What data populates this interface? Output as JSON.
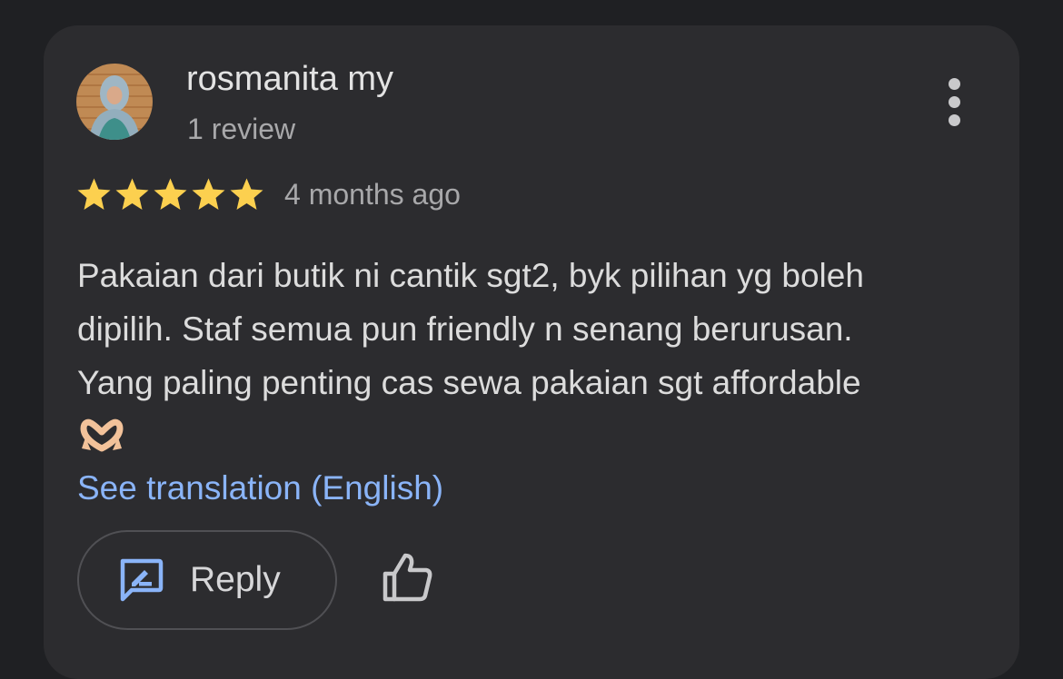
{
  "review": {
    "author_name": "rosmanita my",
    "review_count": "1 review",
    "rating": 5,
    "rating_max": 5,
    "time_ago": "4 months ago",
    "text_lines": [
      "Pakaian dari butik ni cantik sgt2, byk pilihan yg boleh",
      "dipilih. Staf semua pun friendly n senang berurusan.",
      "Yang paling penting cas sewa pakaian sgt affordable"
    ],
    "emoji": "heart-hands",
    "translate_link": "See translation (English)"
  },
  "actions": {
    "reply_label": "Reply",
    "reply_icon": "rate-review-icon",
    "like_icon": "thumbs-up-icon",
    "more_icon": "more-vert-icon"
  },
  "colors": {
    "background": "#1f2023",
    "card": "#2c2c2f",
    "star": "#fcd04f",
    "link": "#8ab4f8",
    "reply_icon": "#8ab4f8"
  }
}
